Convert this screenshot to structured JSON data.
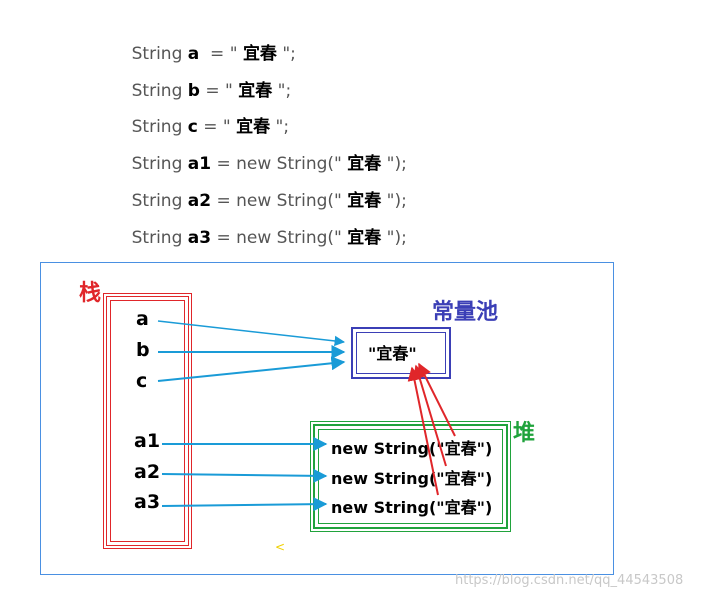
{
  "code": {
    "lines": [
      {
        "kw": "String ",
        "var": "a",
        "op": "  = \" ",
        "val": "宜春",
        "end": " \";"
      },
      {
        "kw": "String ",
        "var": "b",
        "op": " = \" ",
        "val": "宜春",
        "end": " \";"
      },
      {
        "kw": "String ",
        "var": "c",
        "op": " = \" ",
        "val": "宜春",
        "end": " \";"
      },
      {
        "kw": "String ",
        "var": "a1",
        "op": " = new String(\" ",
        "val": "宜春",
        "end": " \");"
      },
      {
        "kw": "String ",
        "var": "a2",
        "op": " = new String(\" ",
        "val": "宜春",
        "end": " \");"
      },
      {
        "kw": "String ",
        "var": "a3",
        "op": " = new String(\" ",
        "val": "宜春",
        "end": " \");"
      }
    ]
  },
  "diagram": {
    "stack_title": "栈",
    "pool_title": "常量池",
    "heap_title": "堆",
    "stack_vars": [
      "a",
      "b",
      "c",
      "a1",
      "a2",
      "a3"
    ],
    "pool_value": "\"宜春\"",
    "heap_objects": [
      "new String(\"宜春\")",
      "new String(\"宜春\")",
      "new String(\"宜春\")"
    ],
    "marker": "<"
  },
  "watermark": "https://blog.csdn.net/qq_44543508",
  "colors": {
    "stack": "#e0262a",
    "pool": "#3b3fb6",
    "heap": "#20a33c",
    "reference_arrow": "#1a9bd7",
    "pool_reference_arrow": "#e0262a",
    "frame": "#4a90e2"
  }
}
